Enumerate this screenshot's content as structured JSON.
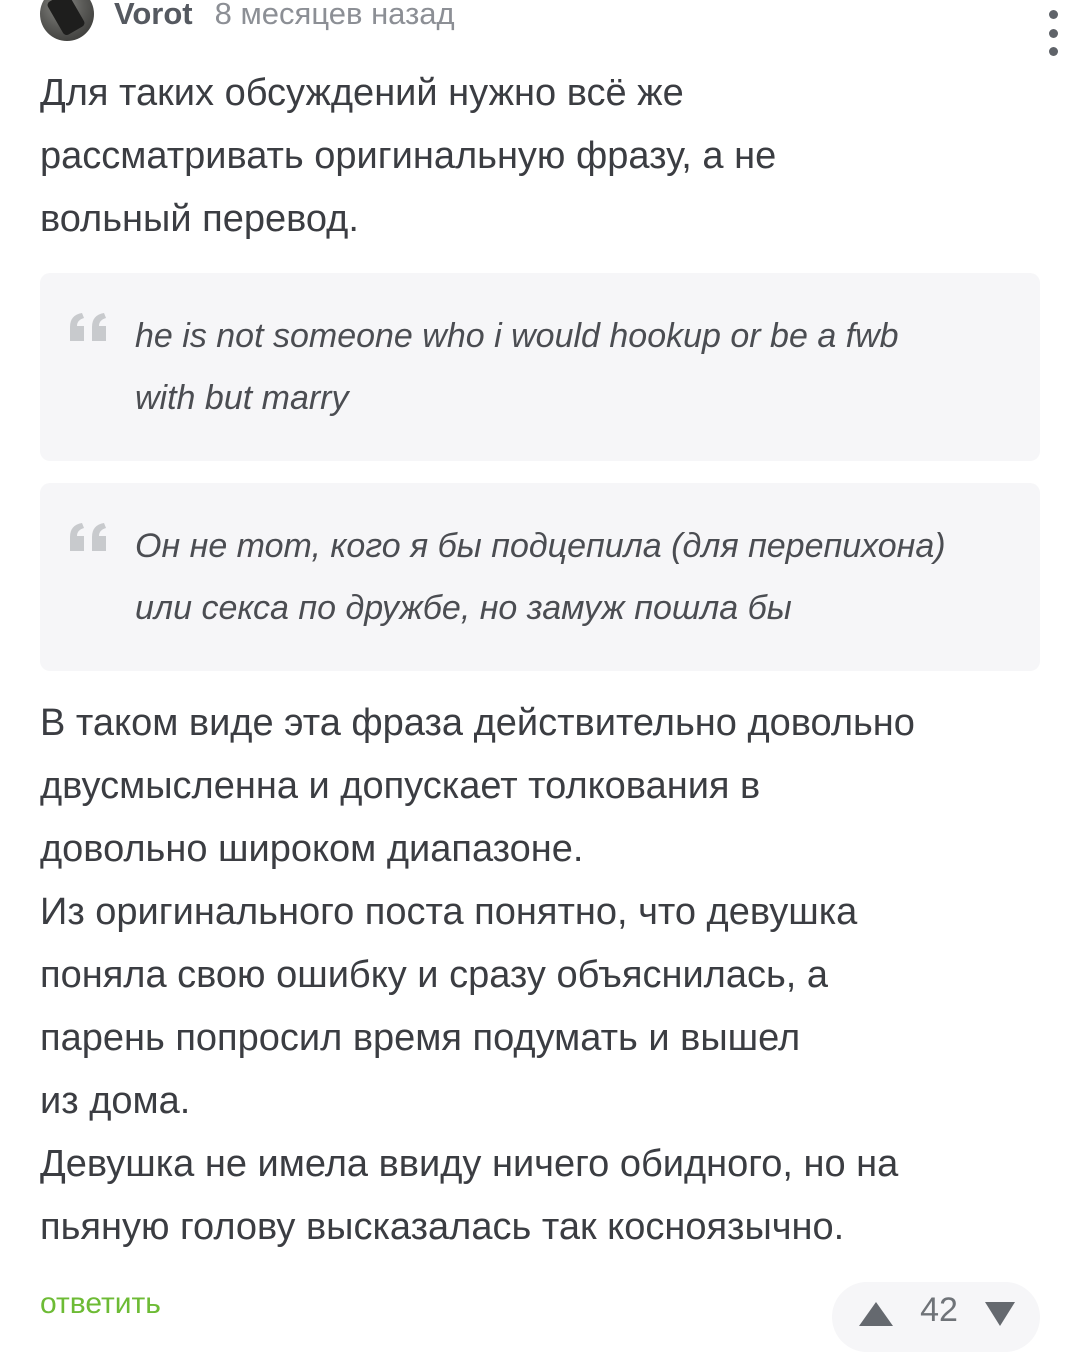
{
  "comment": {
    "author": "Vorot",
    "timestamp": "8 месяцев назад",
    "icons": {
      "avatar": "user-avatar",
      "more": "vertical-ellipsis-icon",
      "quote": "quote-mark-icon",
      "upvote": "triangle-up-icon",
      "downvote": "triangle-down-icon"
    },
    "intro": "Для таких обсуждений нужно всё же\nрассматривать оригинальную фразу, а не\nвольный перевод.",
    "quotes": [
      {
        "text": "he is not someone who i would hookup or be a fwb\nwith but marry"
      },
      {
        "text": "Он не тот, кого я бы подцепила (для перепихона)\nили секса по дружбе, но замуж пошла бы"
      }
    ],
    "body": "В таком виде эта фраза действительно довольно\nдвусмысленна и допускает толкования в\nдовольно широком диапазоне.\nИз оригинального поста понятно, что девушка\nпоняла свою ошибку и сразу объяснилась, а\nпарень попросил время подумать и вышел\nиз дома.\nДевушка не имела ввиду ничего обидного, но на\nпьяную голову высказалась так косноязычно.",
    "reply_label": "ответить",
    "rating": "42",
    "colors": {
      "accent_green": "#6dbb35",
      "quote_background": "#f6f6f8",
      "text_primary": "#3b3d42"
    }
  }
}
